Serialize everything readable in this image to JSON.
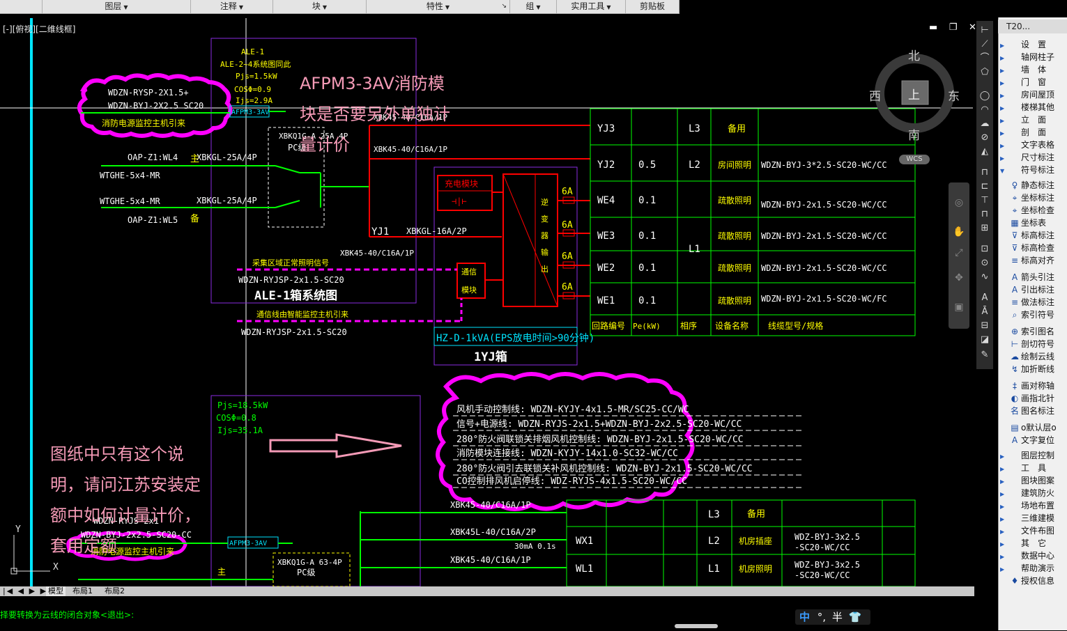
{
  "ribbon": {
    "tabs": [
      {
        "label": "图层",
        "arrow": true
      },
      {
        "label": "注释",
        "arrow": true
      },
      {
        "label": "块",
        "arrow": true
      },
      {
        "label": "特性",
        "arrow": true
      },
      {
        "label": "组",
        "arrow": true
      },
      {
        "label": "实用工具",
        "arrow": true
      },
      {
        "label": "剪贴板",
        "arrow": false
      }
    ]
  },
  "viewport": {
    "label": "[-][俯视][二维线框]",
    "controls": "▬ ❐ ✕"
  },
  "compass": {
    "north": "北",
    "south": "南",
    "east": "东",
    "west": "西",
    "center": "上",
    "wcs": "WCS"
  },
  "annotations": {
    "top_question_line1": "AFPM3-3AV消防模",
    "top_question_line2": "块是否要另外单独计",
    "top_question_line3": "量计价",
    "bottom_note_line1": "图纸中只有这个说",
    "bottom_note_line2": "明，请问江苏安装定",
    "bottom_note_line3": "额中如何计量计价，",
    "bottom_note_line4": "套用定额"
  },
  "drawing": {
    "ale1_title": "ALE-1",
    "ale1_sub": "ALE-2~4系统图同此",
    "pjs1": "Pjs=1.5kW",
    "cos1": "COSΦ=0.9",
    "ijs1": "Ijs=2.9A",
    "afpm": "AFPM3-3AV",
    "cable_wdzn_rysp": "WDZN-RYSP-2X1.5+",
    "cable_wdzn_byj": "WDZN-BYJ-2X2.5 SC20",
    "cloud_text1": "消防电源监控主机引来",
    "xbkq1g": "XBKQ1G-A 25A 4P",
    "pc_level": "PC级",
    "xbk_top": "XBK45-40/C16A/1P",
    "xbk_second": "XBK45-40/C16A/1P",
    "oap_wl4": "OAP-Z1:WL4",
    "oap_wl5": "OAP-Z1:WL5",
    "wtghe1": "WTGHE-5x4-MR",
    "wtghe2": "WTGHE-5x4-MR",
    "xbkgl1": "XBKGL-25A/4P",
    "xbkgl2": "XBKGL-25A/4P",
    "zhu": "主",
    "bei": "备",
    "yj1": "YJ1",
    "xbkgl16": "XBKGL-16A/2P",
    "xbk_bottom": "XBK45-40/C16A/1P",
    "charger": "充电模块",
    "comm_module_1": "通信",
    "comm_module_2": "模块",
    "inverter_labels": [
      "逆",
      "变",
      "器",
      "输",
      "出"
    ],
    "amp6": "6A",
    "caiji": "采集区域正常照明信号",
    "wdzn_rjsp": "WDZN-RYJSP-2x1.5-SC20",
    "ale1_box_title": "ALE-1箱系统图",
    "tongxin": "通信线由智能监控主机引来",
    "wdzn_rjsp2": "WDZN-RYJSP-2x1.5-SC20",
    "hz": "HZ-D-1kVA(EPS放电时间>90分钟)",
    "yj_box": "1YJ箱",
    "pjs2": "Pjs=18.5kW",
    "cos2": "COSΦ=0.8",
    "ijs2": "Ijs=35.1A",
    "wdzn_ryj_bottom": "WDZN-RYJS-2x1",
    "wdzn_byj_bottom": "WDZN-BYJ-2x2.5-SC20-CC",
    "cloud_text2": "消防电源监控主机引来",
    "afpm2": "AFPM3-3AV",
    "xbkq1g_63": "XBKQ1G-A 63-4P",
    "pc_level2": "PC级",
    "wdzn_bottom_cut": "WDZN-BYJ-2x1.5-SC20-WC",
    "bottom_breaker1": "XBK45-40/C16A/1P",
    "bottom_breaker2": "XBK45L-40/C16A/2P",
    "bottom_breaker2b": "30mA  0.1s",
    "bottom_breaker3": "XBK45-40/C16A/1P"
  },
  "table_top": {
    "rows": [
      {
        "circuit": "YJ3",
        "power": "",
        "phase": "L3",
        "device": "备用",
        "cable": ""
      },
      {
        "circuit": "YJ2",
        "power": "0.5",
        "phase": "L2",
        "device": "房间照明",
        "cable": "WDZN-BYJ-3*2.5-SC20-WC/CC"
      },
      {
        "circuit": "WE4",
        "power": "0.1",
        "phase": "",
        "device": "疏散照明",
        "cable": "WDZN-BYJ-2x1.5-SC20-WC/CC"
      },
      {
        "circuit": "WE3",
        "power": "0.1",
        "phase": "L1",
        "device": "疏散照明",
        "cable": "WDZN-BYJ-2x1.5-SC20-WC/CC"
      },
      {
        "circuit": "WE2",
        "power": "0.1",
        "phase": "",
        "device": "疏散照明",
        "cable": "WDZN-BYJ-2x1.5-SC20-WC/CC"
      },
      {
        "circuit": "WE1",
        "power": "0.1",
        "phase": "",
        "device": "疏散照明",
        "cable": "WDZN-BYJ-2x1.5-SC20-WC/FC"
      }
    ],
    "headers": [
      "回路编号",
      "Pe(kW)",
      "相序",
      "设备名称",
      "线缆型号/规格"
    ]
  },
  "table_bottom": {
    "rows": [
      {
        "circuit": "",
        "phase": "L3",
        "device": "备用",
        "cable1": "",
        "cable2": ""
      },
      {
        "circuit": "WX1",
        "phase": "L2",
        "device": "机房插座",
        "cable1": "WDZ-BYJ-3x2.5",
        "cable2": "-SC20-WC/CC"
      },
      {
        "circuit": "WL1",
        "phase": "L1",
        "device": "机房照明",
        "cable1": "WDZ-BYJ-3x2.5",
        "cable2": "-SC20-WC/CC"
      }
    ]
  },
  "cloud_notes": [
    "风机手动控制线: WDZN-KYJY-4x1.5-MR/SC25-CC/WC",
    "信号+电源线: WDZN-RYJS-2x1.5+WDZN-BYJ-2x2.5-SC20-WC/CC",
    "280°防火阀联锁关排烟风机控制线: WDZN-BYJ-2x1.5-SC20-WC/CC",
    "消防模块连接线: WDZN-KYJY-14x1.0-SC32-WC/CC",
    "280°防火阀引去联锁关补风机控制线: WDZN-BYJ-2x1.5-SC20-WC/CC",
    "CO控制排风机启停线: WDZ-RYJS-4x1.5-SC20-WC/CC"
  ],
  "right_panel": {
    "title": "T20...",
    "items": [
      {
        "label": "设　置",
        "icon": "",
        "tri": "▶"
      },
      {
        "label": "轴网柱子",
        "icon": "",
        "tri": "▶"
      },
      {
        "label": "墙　体",
        "icon": "",
        "tri": "▶"
      },
      {
        "label": "门　窗",
        "icon": "",
        "tri": "▶"
      },
      {
        "label": "房间屋顶",
        "icon": "",
        "tri": "▶"
      },
      {
        "label": "楼梯其他",
        "icon": "",
        "tri": "▶"
      },
      {
        "label": "立　面",
        "icon": "",
        "tri": "▶"
      },
      {
        "label": "剖　面",
        "icon": "",
        "tri": "▶"
      },
      {
        "label": "文字表格",
        "icon": "",
        "tri": "▶"
      },
      {
        "label": "尺寸标注",
        "icon": "",
        "tri": "▶"
      },
      {
        "label": "符号标注",
        "icon": "",
        "tri": "▼"
      },
      {
        "label": "静态标注",
        "icon": "♀",
        "tri": ""
      },
      {
        "label": "坐标标注",
        "icon": "⌖",
        "tri": ""
      },
      {
        "label": "坐标检查",
        "icon": "⌖",
        "tri": ""
      },
      {
        "label": "坐标表",
        "icon": "▦",
        "tri": ""
      },
      {
        "label": "标高标注",
        "icon": "⊽",
        "tri": ""
      },
      {
        "label": "标高检查",
        "icon": "⊽",
        "tri": ""
      },
      {
        "label": "标高对齐",
        "icon": "≡",
        "tri": ""
      },
      {
        "label": "箭头引注",
        "icon": "A",
        "tri": ""
      },
      {
        "label": "引出标注",
        "icon": "A",
        "tri": ""
      },
      {
        "label": "做法标注",
        "icon": "≡",
        "tri": ""
      },
      {
        "label": "索引符号",
        "icon": "⌕",
        "tri": ""
      },
      {
        "label": "索引图名",
        "icon": "⊕",
        "tri": ""
      },
      {
        "label": "剖切符号",
        "icon": "⊢",
        "tri": ""
      },
      {
        "label": "绘制云线",
        "icon": "☁",
        "tri": ""
      },
      {
        "label": "加折断线",
        "icon": "↯",
        "tri": ""
      },
      {
        "label": "画对称轴",
        "icon": "‡",
        "tri": ""
      },
      {
        "label": "画指北针",
        "icon": "◐",
        "tri": ""
      },
      {
        "label": "图名标注",
        "icon": "名",
        "tri": ""
      },
      {
        "label": "o默认层o",
        "icon": "▤",
        "tri": ""
      },
      {
        "label": "文字复位",
        "icon": "A",
        "tri": ""
      },
      {
        "label": "图层控制",
        "icon": "",
        "tri": "▶"
      },
      {
        "label": "工　具",
        "icon": "",
        "tri": "▶"
      },
      {
        "label": "图块图案",
        "icon": "",
        "tri": "▶"
      },
      {
        "label": "建筑防火",
        "icon": "",
        "tri": "▶"
      },
      {
        "label": "场地布置",
        "icon": "",
        "tri": "▶"
      },
      {
        "label": "三维建模",
        "icon": "",
        "tri": "▶"
      },
      {
        "label": "文件布图",
        "icon": "",
        "tri": "▶"
      },
      {
        "label": "其　它",
        "icon": "",
        "tri": "▶"
      },
      {
        "label": "数据中心",
        "icon": "",
        "tri": "▶"
      },
      {
        "label": "帮助演示",
        "icon": "",
        "tri": "▶"
      },
      {
        "label": "授权信息",
        "icon": "♦",
        "tri": ""
      }
    ]
  },
  "layout_tabs": {
    "model": "模型",
    "layout1": "布局1",
    "layout2": "布局2"
  },
  "command_line": "择要转换为云线的闭合对象<退出>:",
  "ime": {
    "lang": "中",
    "punct": "°,",
    "width": "半",
    "skin": "👕"
  },
  "ucs": {
    "y": "Y",
    "x": "X"
  }
}
